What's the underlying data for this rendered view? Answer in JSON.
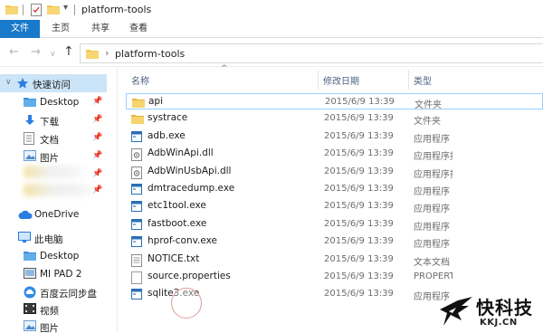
{
  "window": {
    "title": "platform-tools"
  },
  "ribbon": {
    "tabs": [
      "文件",
      "主页",
      "共享",
      "查看"
    ]
  },
  "address": {
    "path": "platform-tools"
  },
  "nav": {
    "quick_access": "快速访问",
    "items": [
      {
        "label": "Desktop",
        "icon": "desktop-folder-icon"
      },
      {
        "label": "下载",
        "icon": "download-icon"
      },
      {
        "label": "文档",
        "icon": "documents-icon"
      },
      {
        "label": "图片",
        "icon": "pictures-icon"
      }
    ],
    "onedrive": "OneDrive",
    "this_pc": "此电脑",
    "pc_items": [
      {
        "label": "Desktop",
        "icon": "desktop-folder-icon"
      },
      {
        "label": "MI PAD 2",
        "icon": "tablet-device-icon"
      },
      {
        "label": "百度云同步盘",
        "icon": "baidu-cloud-icon"
      },
      {
        "label": "视频",
        "icon": "videos-icon"
      },
      {
        "label": "图片",
        "icon": "pictures-icon"
      }
    ]
  },
  "columns": {
    "name": "名称",
    "date": "修改日期",
    "type": "类型"
  },
  "files": [
    {
      "name": "api",
      "date": "2015/6/9 13:39",
      "type": "文件夹",
      "icon": "folder-icon"
    },
    {
      "name": "systrace",
      "date": "2015/6/9 13:39",
      "type": "文件夹",
      "icon": "folder-icon"
    },
    {
      "name": "adb.exe",
      "date": "2015/6/9 13:39",
      "type": "应用程序",
      "icon": "executable-icon"
    },
    {
      "name": "AdbWinApi.dll",
      "date": "2015/6/9 13:39",
      "type": "应用程序扩",
      "icon": "dll-icon"
    },
    {
      "name": "AdbWinUsbApi.dll",
      "date": "2015/6/9 13:39",
      "type": "应用程序扩",
      "icon": "dll-icon"
    },
    {
      "name": "dmtracedump.exe",
      "date": "2015/6/9 13:39",
      "type": "应用程序",
      "icon": "executable-icon"
    },
    {
      "name": "etc1tool.exe",
      "date": "2015/6/9 13:39",
      "type": "应用程序",
      "icon": "executable-icon"
    },
    {
      "name": "fastboot.exe",
      "date": "2015/6/9 13:39",
      "type": "应用程序",
      "icon": "executable-icon"
    },
    {
      "name": "hprof-conv.exe",
      "date": "2015/6/9 13:39",
      "type": "应用程序",
      "icon": "executable-icon"
    },
    {
      "name": "NOTICE.txt",
      "date": "2015/6/9 13:39",
      "type": "文本文档",
      "icon": "text-file-icon"
    },
    {
      "name": "source.properties",
      "date": "2015/6/9 13:39",
      "type": "PROPERTIES",
      "icon": "properties-file-icon"
    },
    {
      "name": "sqlite3.exe",
      "date": "2015/6/9 13:39",
      "type": "应用程序",
      "icon": "executable-icon"
    }
  ],
  "watermark": {
    "title": "快科技",
    "url": "KKJ.CN"
  },
  "colors": {
    "accent": "#1979ca",
    "selected": "#cce4f7",
    "folder": "#f3c74f"
  }
}
